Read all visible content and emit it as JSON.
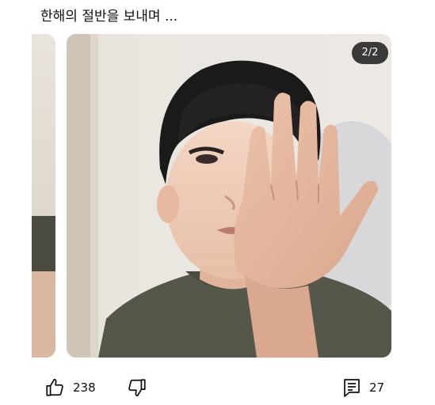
{
  "post": {
    "text": "한해의 절반을 보내며 ..."
  },
  "carousel": {
    "counter": "2/2",
    "image_description_icon": "photo"
  },
  "actions": {
    "like_count": "238",
    "comment_count": "27",
    "like_icon": "thumbs-up-icon",
    "dislike_icon": "thumbs-down-icon",
    "comment_icon": "comment-icon"
  }
}
